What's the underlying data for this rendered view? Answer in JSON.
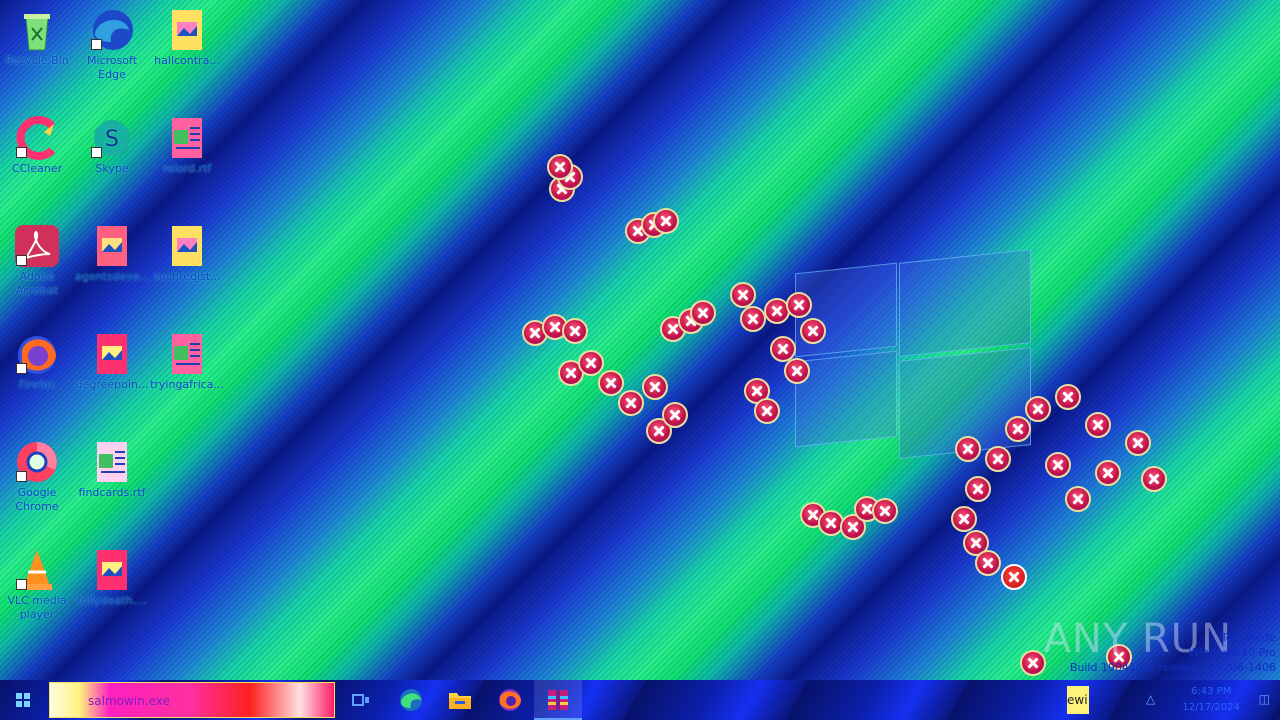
{
  "desktop": {
    "icons": [
      {
        "label": "Recycle Bin",
        "icon": "recycle-bin-icon"
      },
      {
        "label": "Microsoft Edge",
        "icon": "edge-icon"
      },
      {
        "label": "hallcontra...",
        "icon": "image-file-icon"
      },
      {
        "label": "CCleaner",
        "icon": "ccleaner-icon"
      },
      {
        "label": "Skype",
        "icon": "skype-icon"
      },
      {
        "label": "relord.rtf",
        "icon": "rtf-file-icon"
      },
      {
        "label": "Adobe Acrobat",
        "icon": "acrobat-icon"
      },
      {
        "label": "agentsdeve...",
        "icon": "image-file-icon"
      },
      {
        "label": "suchregist...",
        "icon": "image-file-icon"
      },
      {
        "label": "Firefox",
        "icon": "firefox-icon"
      },
      {
        "label": "degreepoin...",
        "icon": "image-file-icon"
      },
      {
        "label": "tryingafrica...",
        "icon": "rtf-file-icon"
      },
      {
        "label": "Google Chrome",
        "icon": "chrome-icon"
      },
      {
        "label": "findcards.rtf",
        "icon": "rtf-file-icon"
      },
      {
        "label": "VLC media player",
        "icon": "vlc-icon"
      },
      {
        "label": "fullydeath....",
        "icon": "image-file-icon"
      }
    ],
    "watermark": "ANY RUN",
    "mode_lines": [
      "Test Mode",
      "Windows 10 Pro",
      "Build 19041.vb_release.191206-1406"
    ]
  },
  "taskbar": {
    "search_query": "salmowin.exe",
    "apps": [
      {
        "name": "task-view",
        "icon": "task-view-icon"
      },
      {
        "name": "edge",
        "icon": "edge-icon"
      },
      {
        "name": "file-explorer",
        "icon": "folder-icon"
      },
      {
        "name": "firefox",
        "icon": "firefox-icon"
      },
      {
        "name": "winrar",
        "icon": "winrar-icon"
      }
    ],
    "tray_text": "ewi",
    "clock_time": "6:43 PM",
    "clock_date": "12/17/2024"
  },
  "colors": {
    "error_red": "#c0104a",
    "stripe_green": "#27f08a",
    "stripe_blue": "#0b1a8e"
  }
}
